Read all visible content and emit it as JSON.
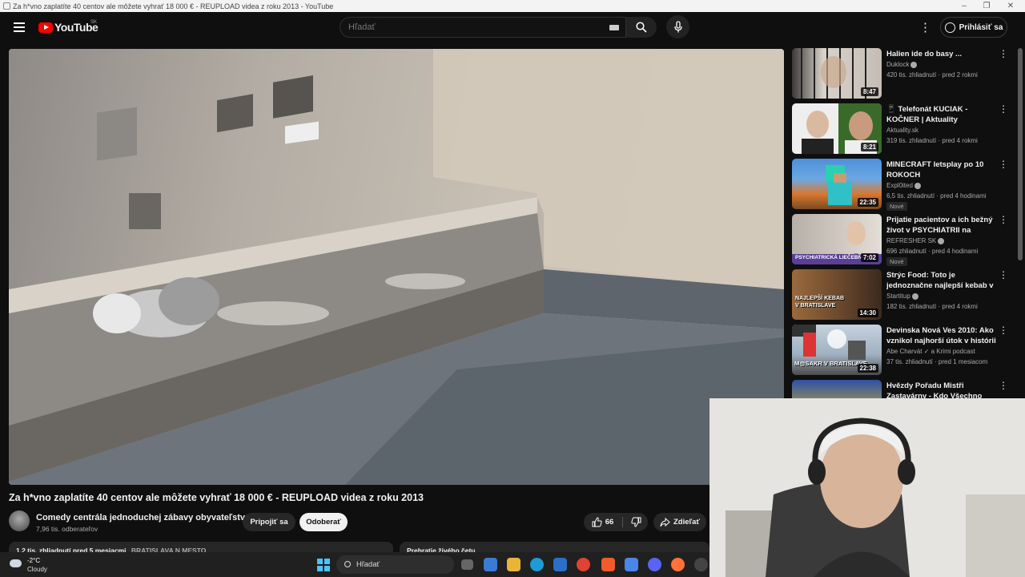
{
  "window": {
    "title": "Za h*vno zaplatíte 40 centov ale môžete vyhrať 18 000 € - REUPLOAD videa z roku 2013 - YouTube",
    "controls": [
      "–",
      "❐",
      "✕"
    ]
  },
  "header": {
    "logo_text": "YouTube",
    "country_code": "SK",
    "search_placeholder": "Hľadať",
    "signin_label": "Prihlásiť sa",
    "icons": [
      "menu-icon",
      "keyboard-icon",
      "search-icon",
      "mic-icon",
      "more-icon",
      "account-icon"
    ]
  },
  "video": {
    "title": "Za h*vno zaplatíte 40 centov ale môžete vyhrať 18 000 € - REUPLOAD videa z roku 2013",
    "channel_name": "Comedy centrála jednoduchej zábavy obyvateľstva",
    "subscribers": "7,96 tis. odberateľov",
    "join_label": "Pripojiť sa",
    "subscribe_label": "Odoberať",
    "likes": "66",
    "share_label": "Zdieľať",
    "description_stats": "1,2 tis. zhliadnutí  pred 5 mesiacmi",
    "description_location": "BRATISLAVA N MESTO",
    "chat_label": "Prehratie živého četu"
  },
  "recommendations": [
    {
      "title": "Halien ide do basy ...",
      "channel": "Duklock",
      "verified": true,
      "meta": "420 tis. zhliadnutí · pred 2 rokmi",
      "duration": "8:47",
      "badge": "",
      "thumb_color": "#c9c4bd"
    },
    {
      "title": "📱 Telefonát  KUCIAK - KOČNER | Aktuality",
      "channel": "Aktuality.sk",
      "verified": false,
      "meta": "319 tis. zhliadnutí · pred 4 rokmi",
      "duration": "8:21",
      "badge": "",
      "thumb_color": "#e8e8e8"
    },
    {
      "title": "MINECRAFT letsplay po 10 ROKOCH",
      "channel": "Expl0ited",
      "verified": true,
      "meta": "6,5 tis. zhliadnutí · pred 4 hodinami",
      "duration": "22:35",
      "badge": "Nové",
      "thumb_color": "#5aa0d8"
    },
    {
      "title": "Prijatie pacientov a ich bežný život v PSYCHIATRII na Predn...",
      "channel": "REFRESHER SK",
      "verified": true,
      "meta": "696 zhliadnutí · pred 4 hodinami",
      "duration": "7:02",
      "badge": "Nové",
      "thumb_color": "#d8d2cc"
    },
    {
      "title": "Strýc Food: Toto je jednoznačne najlepší kebab v Bratislave 👌",
      "channel": "Startitup",
      "verified": true,
      "meta": "182 tis. zhliadnutí · pred 4 rokmi",
      "duration": "14:30",
      "badge": "",
      "thumb_color": "#8a5a38"
    },
    {
      "title": "Devinska Nová Ves 2010: Ako vznikol najhorší útok v histórii ...",
      "channel": "Abe Charvát ✓ a Krimi podcast",
      "verified": false,
      "meta": "37 tis. zhliadnutí · pred 1 mesiacom",
      "duration": "22:38",
      "badge": "",
      "thumb_color": "#b8c4d0"
    },
    {
      "title": "Hvězdy Pořadu Mistři Zastavárny - Kdo Všechno",
      "channel": "",
      "verified": false,
      "meta": "",
      "duration": "",
      "badge": "",
      "thumb_color": "#3a5ab0"
    }
  ],
  "thumb_texts": {
    "rec3": "PSYCHIATRICKÁ LIEČEBŇA",
    "rec4a": "NAJLEPŠÍ KEBAB",
    "rec4b": "V BRATISLAVE",
    "rec5": "M@SAKR V BRATISLAVE"
  },
  "taskbar": {
    "temperature": "-2°C",
    "weather": "Cloudy",
    "search_label": "Hľadať"
  },
  "colors": {
    "background": "#0f0f0f",
    "accent_red": "#ff0000",
    "button_dark": "#272727",
    "text_secondary": "#aaaaaa"
  }
}
